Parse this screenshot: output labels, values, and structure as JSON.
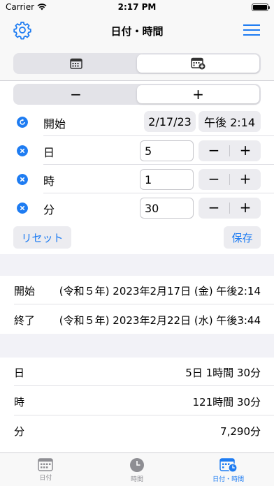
{
  "status_bar": {
    "carrier": "Carrier",
    "time": "2:17 PM"
  },
  "nav": {
    "title": "日付・時間",
    "settings_icon": "gear-icon",
    "menu_icon": "hamburger-icon"
  },
  "mode_segment": {
    "options": [
      "calendar-icon",
      "calendar-plus-icon"
    ],
    "selected_index": 1
  },
  "sign_segment": {
    "options": [
      "−",
      "+"
    ],
    "selected_index": 1
  },
  "rows": {
    "start": {
      "label": "開始",
      "date": "2/17/23",
      "time": "午後 2:14"
    },
    "days": {
      "label": "日",
      "value": "5"
    },
    "hours": {
      "label": "時",
      "value": "1"
    },
    "minutes": {
      "label": "分",
      "value": "30"
    },
    "stepper_minus": "−",
    "stepper_plus": "+"
  },
  "buttons": {
    "reset": "リセット",
    "save": "保存"
  },
  "result": {
    "start": {
      "label": "開始",
      "value": "(令和５年) 2023年2月17日 (金) 午後2:14"
    },
    "end": {
      "label": "終了",
      "value": "(令和５年) 2023年2月22日 (水) 午後3:44"
    }
  },
  "duration": {
    "days": {
      "label": "日",
      "value": "5日 1時間 30分"
    },
    "hours": {
      "label": "時",
      "value": "121時間 30分"
    },
    "minutes": {
      "label": "分",
      "value": "7,290分"
    }
  },
  "tabs": [
    {
      "label": "日付",
      "icon": "calendar-icon",
      "active": false
    },
    {
      "label": "時間",
      "icon": "clock-icon",
      "active": false
    },
    {
      "label": "日付・時間",
      "icon": "calendar-clock-icon",
      "active": true
    }
  ],
  "colors": {
    "accent": "#1e7cf2",
    "background": "#f2f2f7"
  }
}
